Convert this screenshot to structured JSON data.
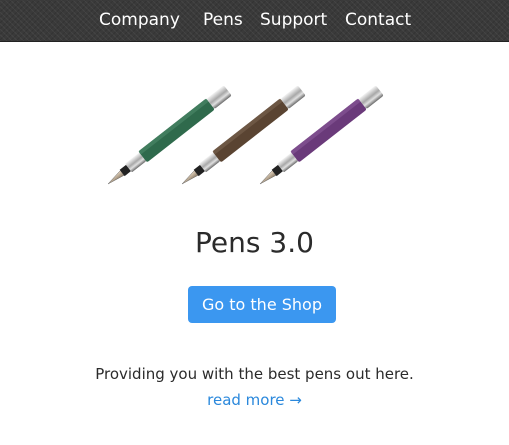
{
  "nav": {
    "items": [
      {
        "label": "Company"
      },
      {
        "label": "Pens"
      },
      {
        "label": "Support"
      },
      {
        "label": "Contact"
      }
    ]
  },
  "hero": {
    "pens": [
      {
        "name": "green-fountain-pen",
        "barrel_color": "#2f6a4c"
      },
      {
        "name": "brown-fountain-pen",
        "barrel_color": "#5a4432"
      },
      {
        "name": "purple-fountain-pen",
        "barrel_color": "#6a3a7a"
      }
    ]
  },
  "main": {
    "title": "Pens 3.0",
    "cta_label": "Go to the Shop",
    "tagline": "Providing you with the best pens out here.",
    "read_more": "read more →"
  },
  "colors": {
    "accent": "#3b97f0",
    "link": "#2a88dc",
    "nav_bg": "#3a3a3a"
  }
}
